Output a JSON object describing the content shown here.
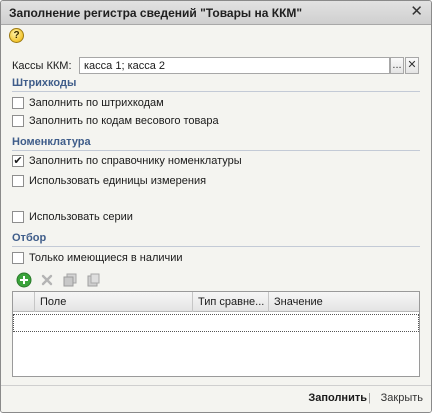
{
  "window": {
    "title": "Заполнение регистра сведений \"Товары на ККМ\"",
    "close_glyph": "✕"
  },
  "help": {
    "glyph": "?"
  },
  "kkm": {
    "label": "Кассы ККМ:",
    "value": "касса 1; касса 2",
    "select_glyph": "...",
    "clear_glyph": "✕"
  },
  "barcodes": {
    "title": "Штрихкоды",
    "items": [
      {
        "label": "Заполнить по штрихкодам",
        "checked": false
      },
      {
        "label": "Заполнить по кодам весового товара",
        "checked": false
      }
    ]
  },
  "nomenclature": {
    "title": "Номенклатура",
    "items": [
      {
        "label": "Заполнить по справочнику номенклатуры",
        "checked": true
      },
      {
        "label": "Использовать единицы измерения",
        "checked": false
      },
      {
        "label": "Использовать серии",
        "checked": false
      }
    ]
  },
  "filter": {
    "title": "Отбор",
    "only_available": {
      "label": "Только имеющиеся в наличии",
      "checked": false
    },
    "toolbar": [
      "add-icon",
      "delete-icon",
      "copy-icon",
      "duplicate-icon"
    ],
    "columns": [
      "Поле",
      "Тип сравне...",
      "Значение"
    ]
  },
  "footer": {
    "fill": "Заполнить",
    "separator": "|",
    "close": "Закрыть"
  },
  "colors": {
    "section": "#3f5d8a",
    "add_green": "#3aa33a"
  },
  "check_glyph": "✔"
}
